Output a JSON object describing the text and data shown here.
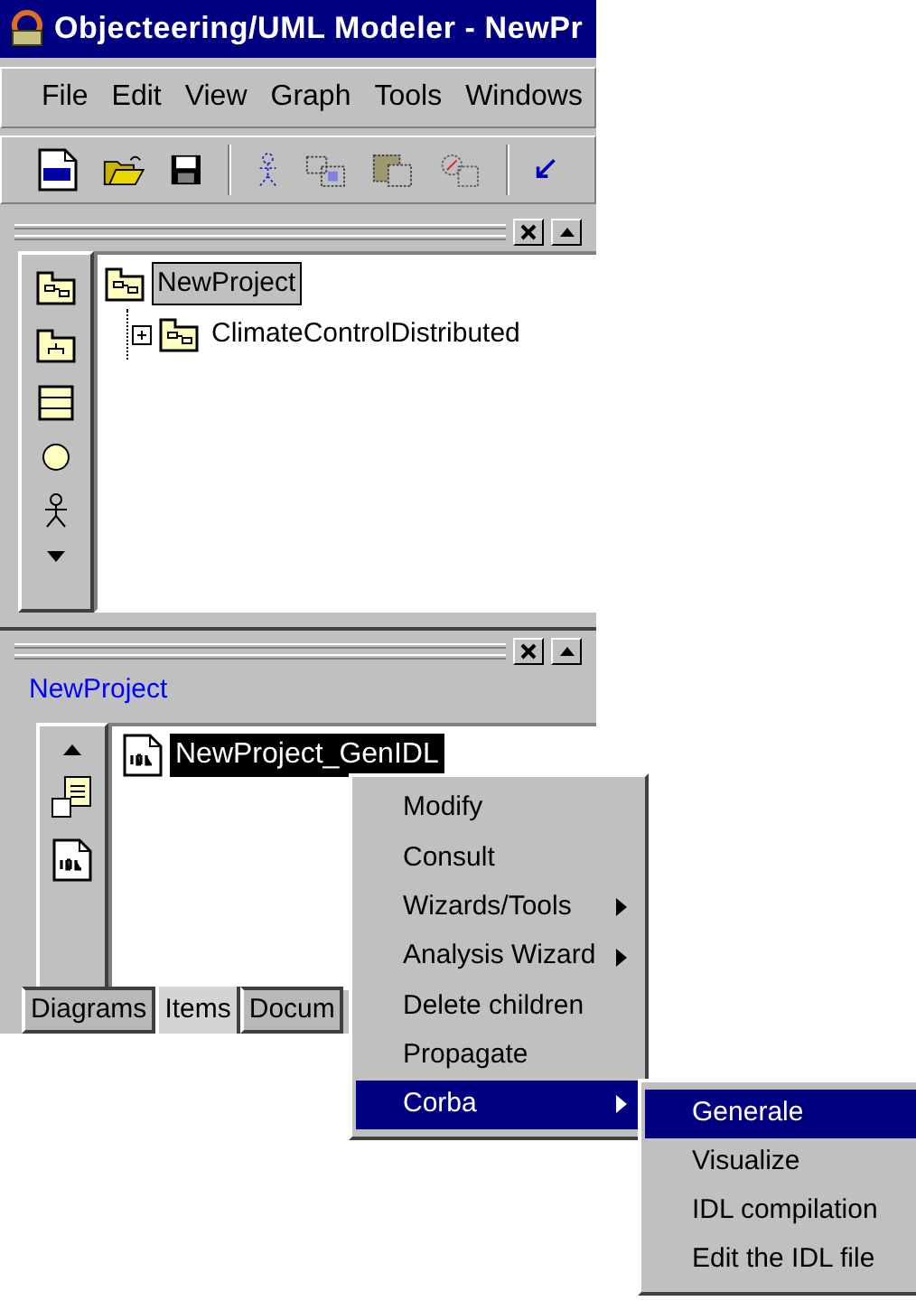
{
  "window": {
    "title": "Objecteering/UML Modeler - NewPr"
  },
  "menu_bar": [
    "File",
    "Edit",
    "View",
    "Graph",
    "Tools",
    "Windows"
  ],
  "explorer": {
    "tree": [
      {
        "label": "NewProject",
        "selected": true,
        "expanded": true,
        "children": [
          {
            "label": "ClimateControlDistributed",
            "selected": false,
            "expanded": false
          }
        ]
      }
    ]
  },
  "items_panel": {
    "title": "NewProject",
    "items": [
      {
        "label": "NewProject_GenIDL",
        "selected": true
      }
    ],
    "tabs": [
      {
        "label": "Diagrams",
        "selected": false
      },
      {
        "label": "Items",
        "selected": true
      },
      {
        "label": "Docum",
        "selected": false
      }
    ]
  },
  "context_menu": [
    {
      "label": "Modify",
      "kind": "command",
      "selected": false
    },
    {
      "label": "Consult",
      "kind": "command",
      "selected": false
    },
    {
      "label": "Wizards/Tools",
      "kind": "submenu",
      "selected": false
    },
    {
      "label": "Analysis Wizard",
      "kind": "submenu",
      "selected": false
    },
    {
      "label": "Delete children",
      "kind": "command",
      "selected": false
    },
    {
      "label": "Propagate",
      "kind": "command",
      "selected": false
    },
    {
      "label": "Corba",
      "kind": "submenu",
      "selected": true
    }
  ],
  "submenu": [
    {
      "label": "Generale",
      "selected": true
    },
    {
      "label": "Visualize",
      "selected": false
    },
    {
      "label": "IDL compilation",
      "selected": false
    },
    {
      "label": "Edit the IDL file",
      "selected": false
    }
  ]
}
